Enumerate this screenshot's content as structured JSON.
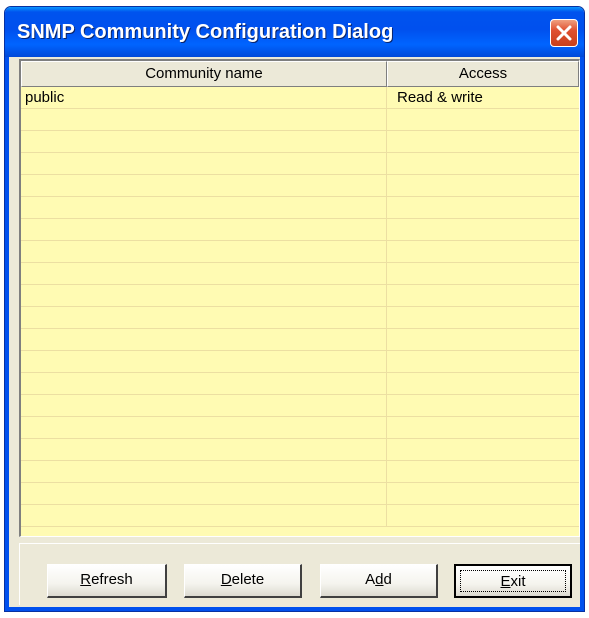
{
  "window": {
    "title": "SNMP Community Configuration Dialog"
  },
  "table": {
    "columns": [
      "Community name",
      "Access"
    ],
    "rows": [
      [
        "public",
        "Read & write"
      ],
      [
        "",
        ""
      ],
      [
        "",
        ""
      ],
      [
        "",
        ""
      ],
      [
        "",
        ""
      ],
      [
        "",
        ""
      ],
      [
        "",
        ""
      ],
      [
        "",
        ""
      ],
      [
        "",
        ""
      ],
      [
        "",
        ""
      ],
      [
        "",
        ""
      ],
      [
        "",
        ""
      ],
      [
        "",
        ""
      ],
      [
        "",
        ""
      ],
      [
        "",
        ""
      ],
      [
        "",
        ""
      ],
      [
        "",
        ""
      ],
      [
        "",
        ""
      ],
      [
        "",
        ""
      ],
      [
        "",
        ""
      ]
    ]
  },
  "buttons": {
    "refresh": {
      "mnemonic": "R",
      "rest": "efresh"
    },
    "delete": {
      "mnemonic": "D",
      "rest": "elete"
    },
    "add": {
      "pre": "A",
      "mnemonic": "d",
      "rest": "d"
    },
    "exit": {
      "mnemonic": "E",
      "rest": "xit"
    }
  },
  "icons": {
    "close": "close-icon"
  },
  "colors": {
    "titlebar": "#0050ee",
    "list_background": "#fffbb3",
    "dialog_background": "#ece9d8",
    "close_button": "#e05030"
  }
}
